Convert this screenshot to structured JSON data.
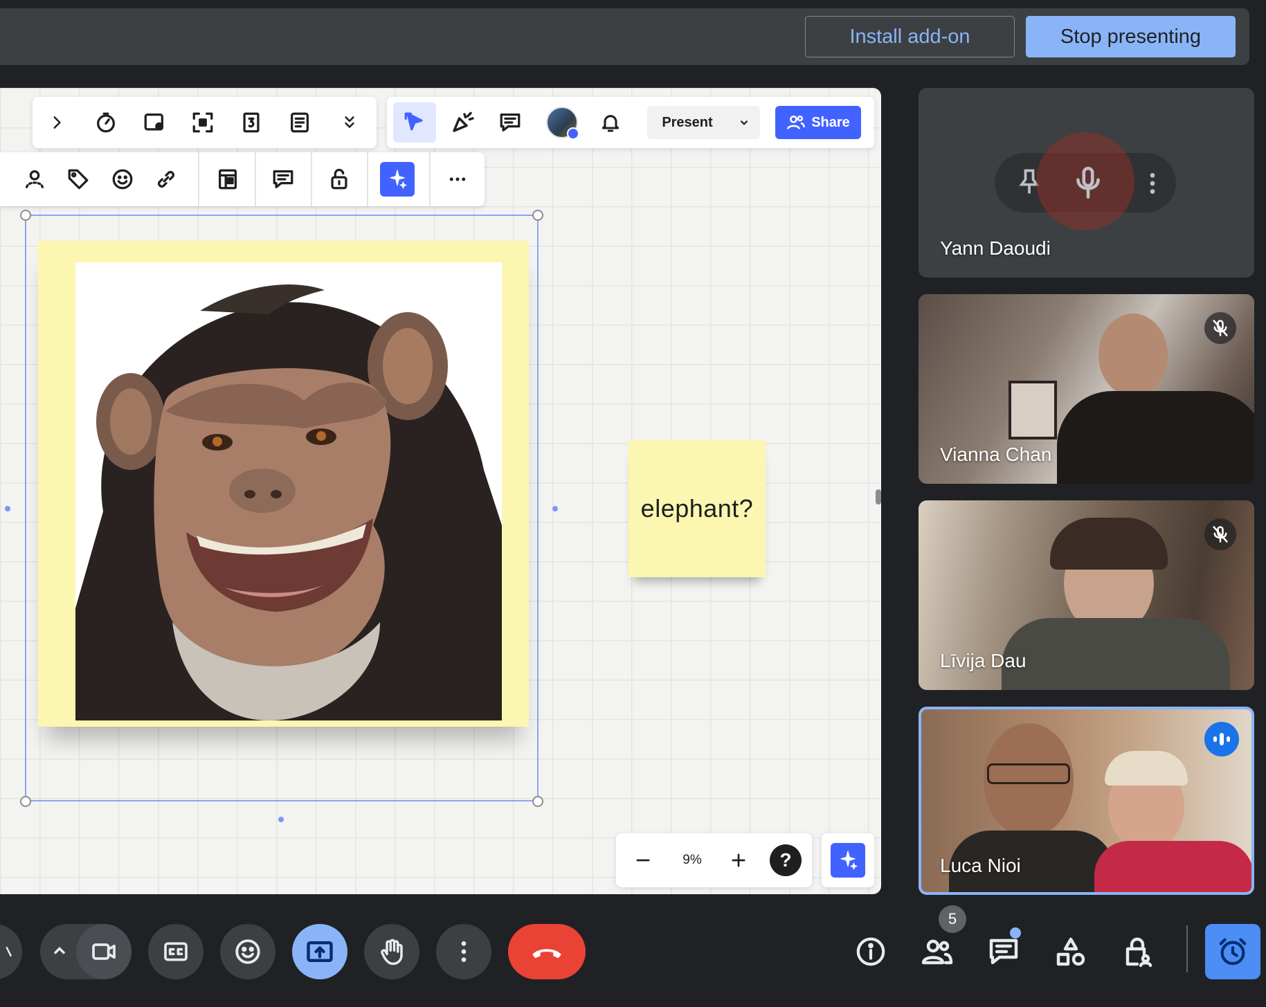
{
  "topbar": {
    "install_addon": "Install add-on",
    "stop_presenting": "Stop presenting"
  },
  "board": {
    "present_label": "Present",
    "share_label": "Share",
    "sticky_note_text": "elephant?",
    "zoom_level": "9%",
    "help_symbol": "?"
  },
  "participants": [
    {
      "name": "Yann Daoudi",
      "muted": false
    },
    {
      "name": "Vianna Chan",
      "muted": true
    },
    {
      "name": "Līvija Dau",
      "muted": true
    },
    {
      "name": "Luca Nioi",
      "speaking": true
    }
  ],
  "bottombar": {
    "people_count": "5"
  },
  "colors": {
    "accent": "#8ab4f8",
    "miro_blue": "#4262ff",
    "end_call": "#ea4335",
    "sticky": "#fbf7b0"
  }
}
